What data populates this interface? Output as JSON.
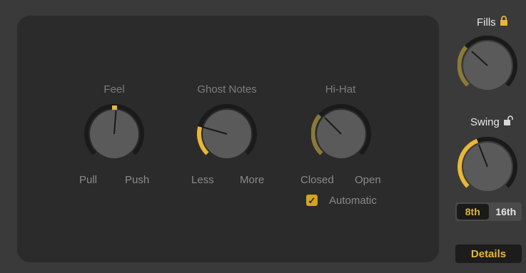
{
  "colors": {
    "accent": "#e9b737",
    "accent_dim": "#8a7a3a",
    "panel": "#2b2b2b",
    "background": "#3a3a3a"
  },
  "knobs": [
    {
      "id": "feel",
      "title": "Feel",
      "left_label": "Pull",
      "right_label": "Push",
      "value": 0.52
    },
    {
      "id": "ghost-notes",
      "title": "Ghost Notes",
      "left_label": "Less",
      "right_label": "More",
      "value": 0.2
    },
    {
      "id": "hi-hat",
      "title": "Hi-Hat",
      "left_label": "Closed",
      "right_label": "Open",
      "value": 0.3
    }
  ],
  "automatic": {
    "label": "Automatic",
    "checked": true,
    "check_glyph": "✓"
  },
  "fills": {
    "title": "Fills",
    "locked": true,
    "lock_icon": "lock-closed-icon",
    "value": 0.3
  },
  "swing": {
    "title": "Swing",
    "locked": false,
    "lock_icon": "lock-open-icon",
    "value": 0.4
  },
  "swing_resolution": {
    "options": [
      "8th",
      "16th"
    ],
    "selected": "8th"
  },
  "details_label": "Details"
}
